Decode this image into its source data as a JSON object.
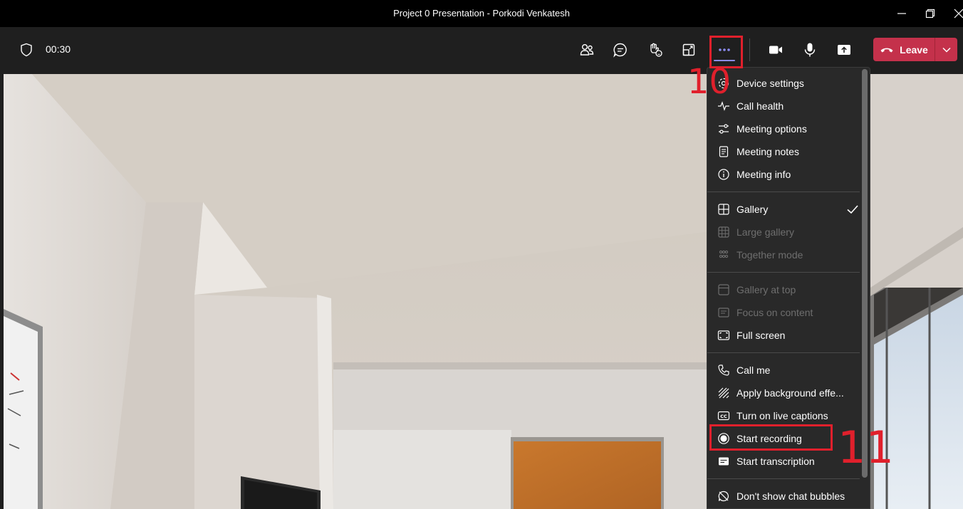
{
  "window": {
    "title": "Project 0 Presentation - Porkodi Venkatesh"
  },
  "toolbar": {
    "timer": "00:30",
    "leave_label": "Leave"
  },
  "menu": {
    "device_settings": "Device settings",
    "call_health": "Call health",
    "meeting_options": "Meeting options",
    "meeting_notes": "Meeting notes",
    "meeting_info": "Meeting info",
    "gallery": "Gallery",
    "large_gallery": "Large gallery",
    "together_mode": "Together mode",
    "gallery_at_top": "Gallery at top",
    "focus_on_content": "Focus on content",
    "full_screen": "Full screen",
    "call_me": "Call me",
    "apply_background": "Apply background effe...",
    "live_captions": "Turn on live captions",
    "start_recording": "Start recording",
    "start_transcription": "Start transcription",
    "chat_bubbles": "Don't show chat bubbles"
  },
  "annotations": {
    "step_10": "10",
    "step_11": "11"
  },
  "colors": {
    "leave": "#c4314b",
    "annotation": "#e0202c",
    "accent": "#8b8cf0",
    "menu_bg": "#292929"
  }
}
